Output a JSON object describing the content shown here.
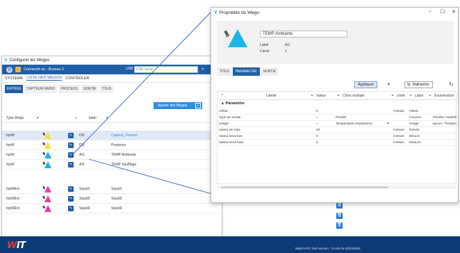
{
  "back_window": {
    "title": "Configurer les Wegos",
    "connected": "Connecté au : Bureau 2",
    "usb_label": "USB",
    "usb_value": "USB Serial",
    "menu": [
      "SYSTEME",
      "LISTE DES WEGOS",
      "CONTROLER"
    ],
    "active_menu": 1,
    "subtabs": [
      "ENTREE",
      "CAPTEUR RADIO",
      "PROCESS",
      "SORTIE",
      "TOUS"
    ],
    "active_subtab": 0,
    "add_button": "Ajouter des Wegos",
    "filter": {
      "type": "Type Wego",
      "label": "label"
    },
    "rows": [
      {
        "type": "InpW",
        "label": "DI1",
        "name": "Capteur_Fenetre",
        "color": "#f4e03a",
        "link": true,
        "hl": true
      },
      {
        "type": "InpW",
        "label": "DI2",
        "name": "Presence",
        "color": "#f4e03a",
        "link": false,
        "hl": false
      },
      {
        "type": "InpW",
        "label": "AI1",
        "name": "TEMP Ambiante",
        "color": "#19b6e6",
        "link": false,
        "hl": false
      },
      {
        "type": "InpW",
        "label": "AI2",
        "name": "TEMP Soufflage",
        "color": "#19b6e6",
        "link": false,
        "hl": false
      },
      {
        "type": "InpWExt",
        "label": "Squid1",
        "name": "Squid1",
        "color": "#e83ea0",
        "link": false,
        "hl": false
      },
      {
        "type": "InpWExt",
        "label": "Squid2",
        "name": "Squid2",
        "color": "#e83ea0",
        "link": false,
        "hl": false
      },
      {
        "type": "InpWExt",
        "label": "Squid3",
        "name": "Squid3",
        "color": "#e83ea0",
        "link": false,
        "hl": false
      }
    ]
  },
  "footer": {
    "brand": "WIT",
    "version": "WINDY-PC Tool Version : 3.6.09 du 02/03/2021"
  },
  "front_window": {
    "title": "Propriétés du Wego",
    "name": "TEMP Ambiante",
    "label_key": "Label",
    "label_val": "AI1",
    "canal_key": "Canal",
    "canal_val": "1",
    "tabs": [
      "TOUS",
      "PARAMETRE",
      "SORTIE"
    ],
    "active_tab": 1,
    "apply_label": "Appliquer",
    "refresh_label": "Rafraichir",
    "columns": [
      "Libellé",
      "Valeur",
      "Choix multiple",
      "Unité",
      "Label",
      "Énumération"
    ],
    "section": "Paramètre",
    "params": [
      {
        "libelle": "Offset",
        "valeur": "0",
        "choix": "",
        "unite": "Celsius",
        "label": "Offset",
        "enum": ""
      },
      {
        "libelle": "Type de sonde",
        "valeur": "1",
        "choix": "Pt1000",
        "unite": "",
        "label": "Convert",
        "enum": "Pt1000 / Ni1000 / ..."
      },
      {
        "libelle": "Usage",
        "valeur": "1",
        "choix": "Température d'ambiance",
        "unite": "",
        "label": "Usage",
        "enum": "aucun / Tempéra..."
      },
      {
        "libelle": "Valeur de repli",
        "valeur": "20",
        "choix": "",
        "unite": "Celsius",
        "label": "DefVal",
        "enum": ""
      },
      {
        "libelle": "Valeur seuil bas",
        "valeur": "0",
        "choix": "",
        "unite": "Celsius",
        "label": "MinLim",
        "enum": ""
      },
      {
        "libelle": "Valeur seuil haut",
        "valeur": "0",
        "choix": "",
        "unite": "Celsius",
        "label": "MaxLim",
        "enum": ""
      }
    ]
  }
}
